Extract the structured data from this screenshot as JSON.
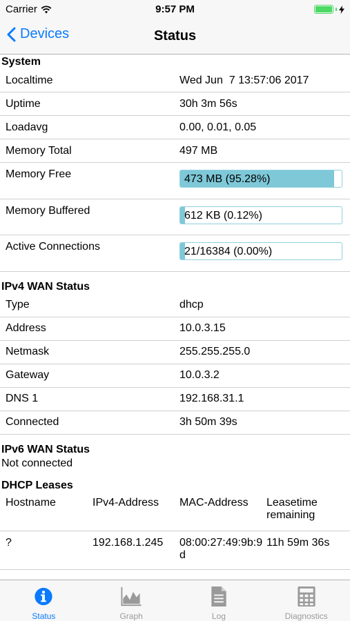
{
  "status_bar": {
    "carrier": "Carrier",
    "time": "9:57 PM"
  },
  "nav": {
    "back_label": "Devices",
    "title": "Status"
  },
  "system": {
    "title": "System",
    "rows": [
      {
        "key": "Localtime",
        "value": "Wed Jun  7 13:57:06 2017"
      },
      {
        "key": "Uptime",
        "value": "30h 3m 56s"
      },
      {
        "key": "Loadavg",
        "value": "0.00, 0.01, 0.05"
      },
      {
        "key": "Memory Total",
        "value": "497 MB"
      }
    ],
    "bars": [
      {
        "key": "Memory Free",
        "value": "473 MB (95.28%)",
        "fraction": 0.9528
      },
      {
        "key": "Memory Buffered",
        "value": "612 KB (0.12%)",
        "fraction": 0.0012
      },
      {
        "key": "Active Connections",
        "value": "21/16384 (0.00%)",
        "fraction": 0.0
      }
    ]
  },
  "ipv4": {
    "title": "IPv4 WAN Status",
    "rows": [
      {
        "key": "Type",
        "value": "dhcp"
      },
      {
        "key": "Address",
        "value": "10.0.3.15"
      },
      {
        "key": "Netmask",
        "value": "255.255.255.0"
      },
      {
        "key": "Gateway",
        "value": "10.0.3.2"
      },
      {
        "key": "DNS 1",
        "value": "192.168.31.1"
      },
      {
        "key": "Connected",
        "value": "3h 50m 39s"
      }
    ]
  },
  "ipv6": {
    "title": "IPv6 WAN Status",
    "status": "Not connected"
  },
  "dhcp": {
    "title": "DHCP Leases",
    "headers": [
      "Hostname",
      "IPv4-Address",
      "MAC-Address",
      "Leasetime remaining"
    ],
    "rows": [
      [
        "?",
        "192.168.1.245",
        "08:00:27:49:9b:9d",
        "11h 59m 36s"
      ]
    ]
  },
  "tabs": [
    {
      "label": "Status",
      "icon": "info-icon",
      "active": true
    },
    {
      "label": "Graph",
      "icon": "graph-icon",
      "active": false
    },
    {
      "label": "Log",
      "icon": "document-icon",
      "active": false
    },
    {
      "label": "Diagnostics",
      "icon": "calculator-icon",
      "active": false
    }
  ],
  "colors": {
    "accent": "#0a7aff",
    "bar_fill": "#7ec8d8",
    "battery": "#4cd964"
  }
}
